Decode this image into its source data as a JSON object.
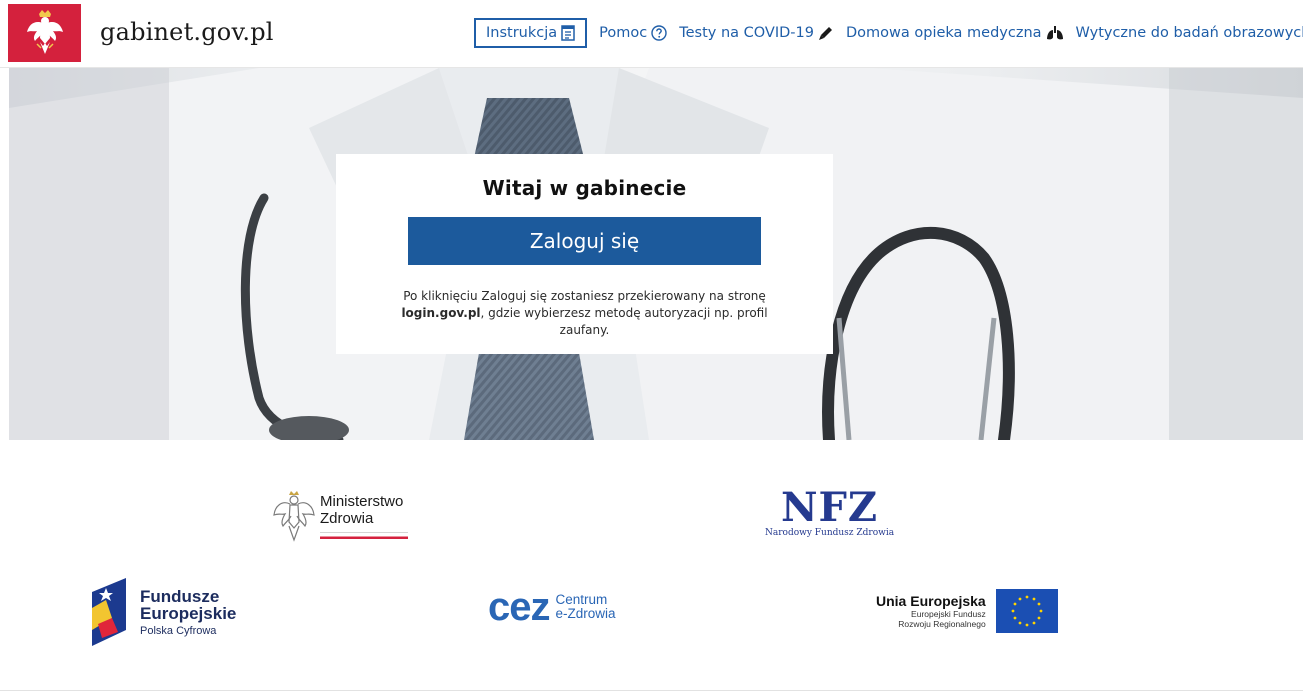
{
  "header": {
    "site_title": "gabinet.gov.pl",
    "emblem_icon": "polish-eagle-emblem",
    "emblem_color": "#d4213d",
    "nav": [
      {
        "label": "Instrukcja",
        "icon": "document-icon",
        "active": true
      },
      {
        "label": "Pomoc",
        "icon": "question-circle-icon",
        "active": false
      },
      {
        "label": "Testy na COVID-19",
        "icon": "swab-icon",
        "active": false
      },
      {
        "label": "Domowa opieka medyczna",
        "icon": "lungs-icon",
        "active": false
      },
      {
        "label": "Wytyczne do badań obrazowych",
        "icon": "radiation-icon",
        "active": false
      }
    ]
  },
  "login": {
    "title": "Witaj w gabinecie",
    "button_label": "Zaloguj się",
    "info_prefix": "Po kliknięciu Zaloguj się zostaniesz przekierowany na stronę ",
    "info_link": "login.gov.pl",
    "info_suffix": ", gdzie wybierzesz metodę autoryzacji np. profil zaufany."
  },
  "logos": {
    "ministerstwo": {
      "line1": "Ministerstwo",
      "line2": "Zdrowia"
    },
    "nfz": {
      "word": "NFZ",
      "sub": "Narodowy Fundusz Zdrowia"
    },
    "fundusze": {
      "line1": "Fundusze",
      "line2": "Europejskie",
      "line3": "Polska Cyfrowa"
    },
    "cez": {
      "word": "cez",
      "line1": "Centrum",
      "line2": "e-Zdrowia"
    },
    "ue": {
      "title": "Unia Europejska",
      "line1": "Europejski Fundusz",
      "line2": "Rozwoju Regionalnego"
    }
  },
  "colors": {
    "accent": "#1c5a9c",
    "link": "#1f5ea8",
    "nfz": "#253a8f",
    "cez": "#2a66b5",
    "eu_flag": "#1b4fb3"
  }
}
